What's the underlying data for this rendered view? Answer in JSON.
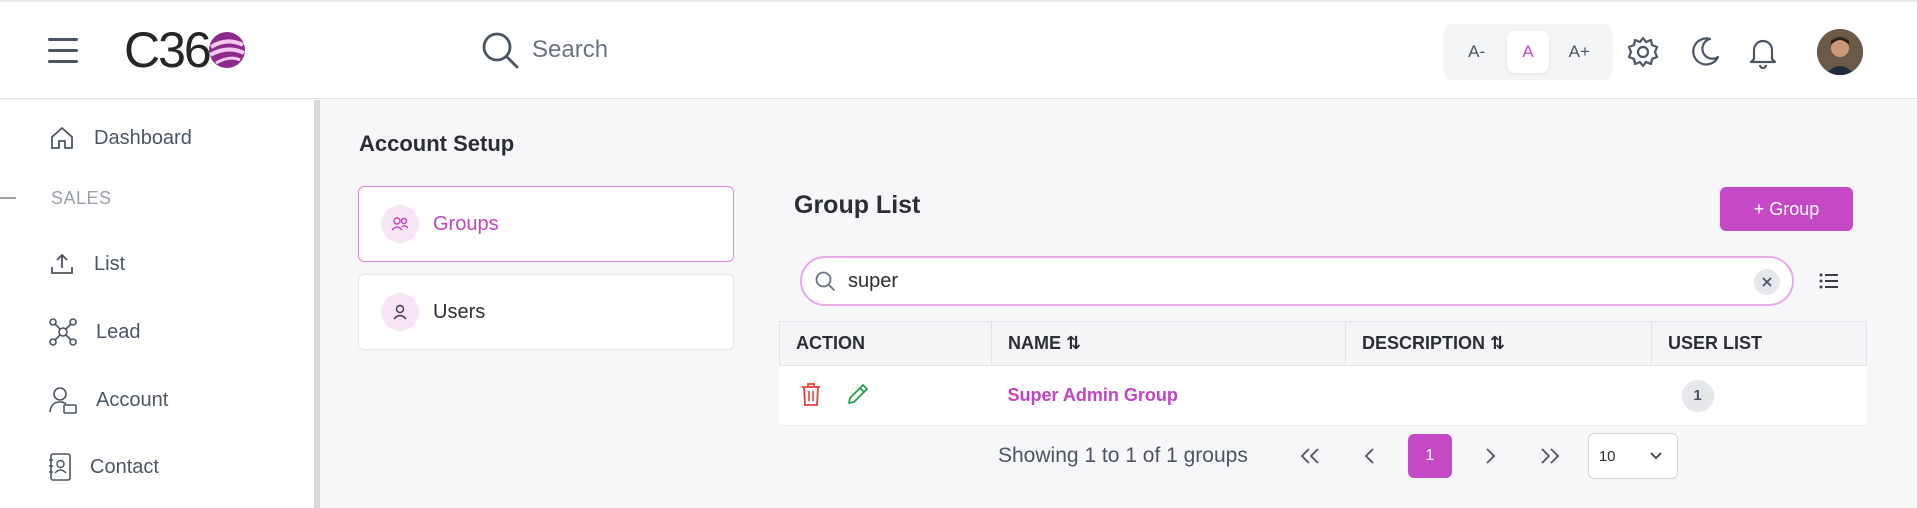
{
  "header": {
    "logo_text": "C36",
    "search_placeholder": "Search",
    "font_controls": [
      "A-",
      "A",
      "A+"
    ],
    "icons": [
      "menu-icon",
      "search-icon",
      "gear-icon",
      "moon-icon",
      "bell-icon"
    ]
  },
  "sidebar": {
    "section": "SALES",
    "items": [
      {
        "label": "Dashboard",
        "icon": "home-icon"
      },
      {
        "label": "List",
        "icon": "upload-icon"
      },
      {
        "label": "Lead",
        "icon": "network-icon"
      },
      {
        "label": "Account",
        "icon": "user-card-icon"
      },
      {
        "label": "Contact",
        "icon": "contact-book-icon"
      }
    ]
  },
  "main": {
    "title": "Account Setup",
    "setup_items": [
      {
        "label": "Groups",
        "icon": "users-icon",
        "active": true
      },
      {
        "label": "Users",
        "icon": "user-icon",
        "active": false
      }
    ],
    "list_title": "Group List",
    "add_button": "+ Group",
    "filter_value": "super",
    "table": {
      "columns": [
        "ACTION",
        "NAME ⇅",
        "DESCRIPTION ⇅",
        "USER LIST"
      ],
      "rows": [
        {
          "name": "Super Admin Group",
          "description": "",
          "user_count": "1"
        }
      ]
    },
    "pagination": {
      "info": "Showing 1 to 1 of 1 groups",
      "current_page": "1",
      "page_size": "10"
    }
  },
  "colors": {
    "accent": "#c548c5",
    "accent_light": "#f6e6f6",
    "delete": "#e53e3e",
    "edit": "#22a04b"
  }
}
